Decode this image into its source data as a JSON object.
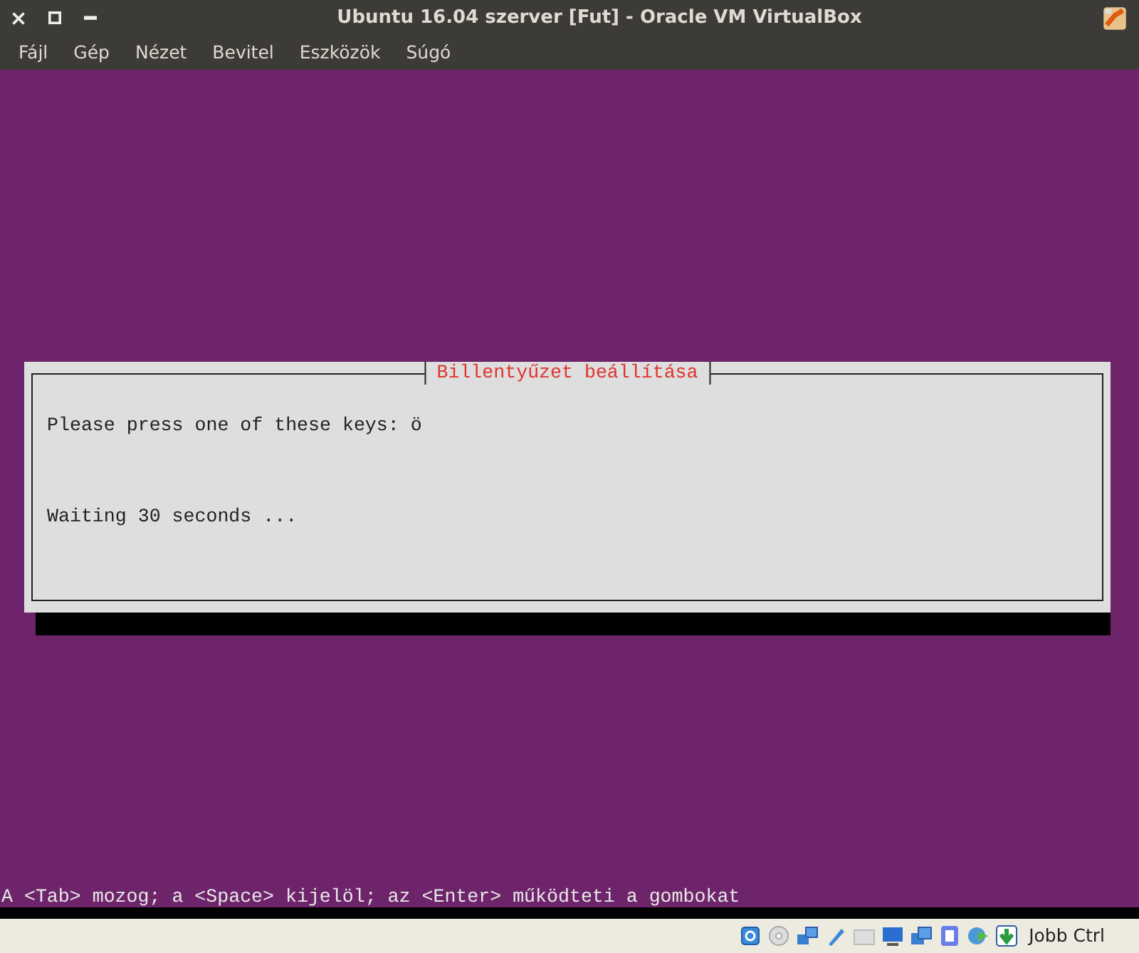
{
  "window": {
    "title": "Ubuntu 16.04 szerver [Fut] - Oracle VM VirtualBox"
  },
  "menu": [
    "Fájl",
    "Gép",
    "Nézet",
    "Bevitel",
    "Eszközök",
    "Súgó"
  ],
  "dialog": {
    "title": "Billentyűzet beállítása",
    "lines": [
      "Please press one of these keys: ö",
      "Waiting 30 seconds ..."
    ]
  },
  "help_line": "A <Tab> mozog; a <Space> kijelöl; az <Enter> működteti a gombokat",
  "status_bar": {
    "host_key": "Jobb Ctrl"
  }
}
